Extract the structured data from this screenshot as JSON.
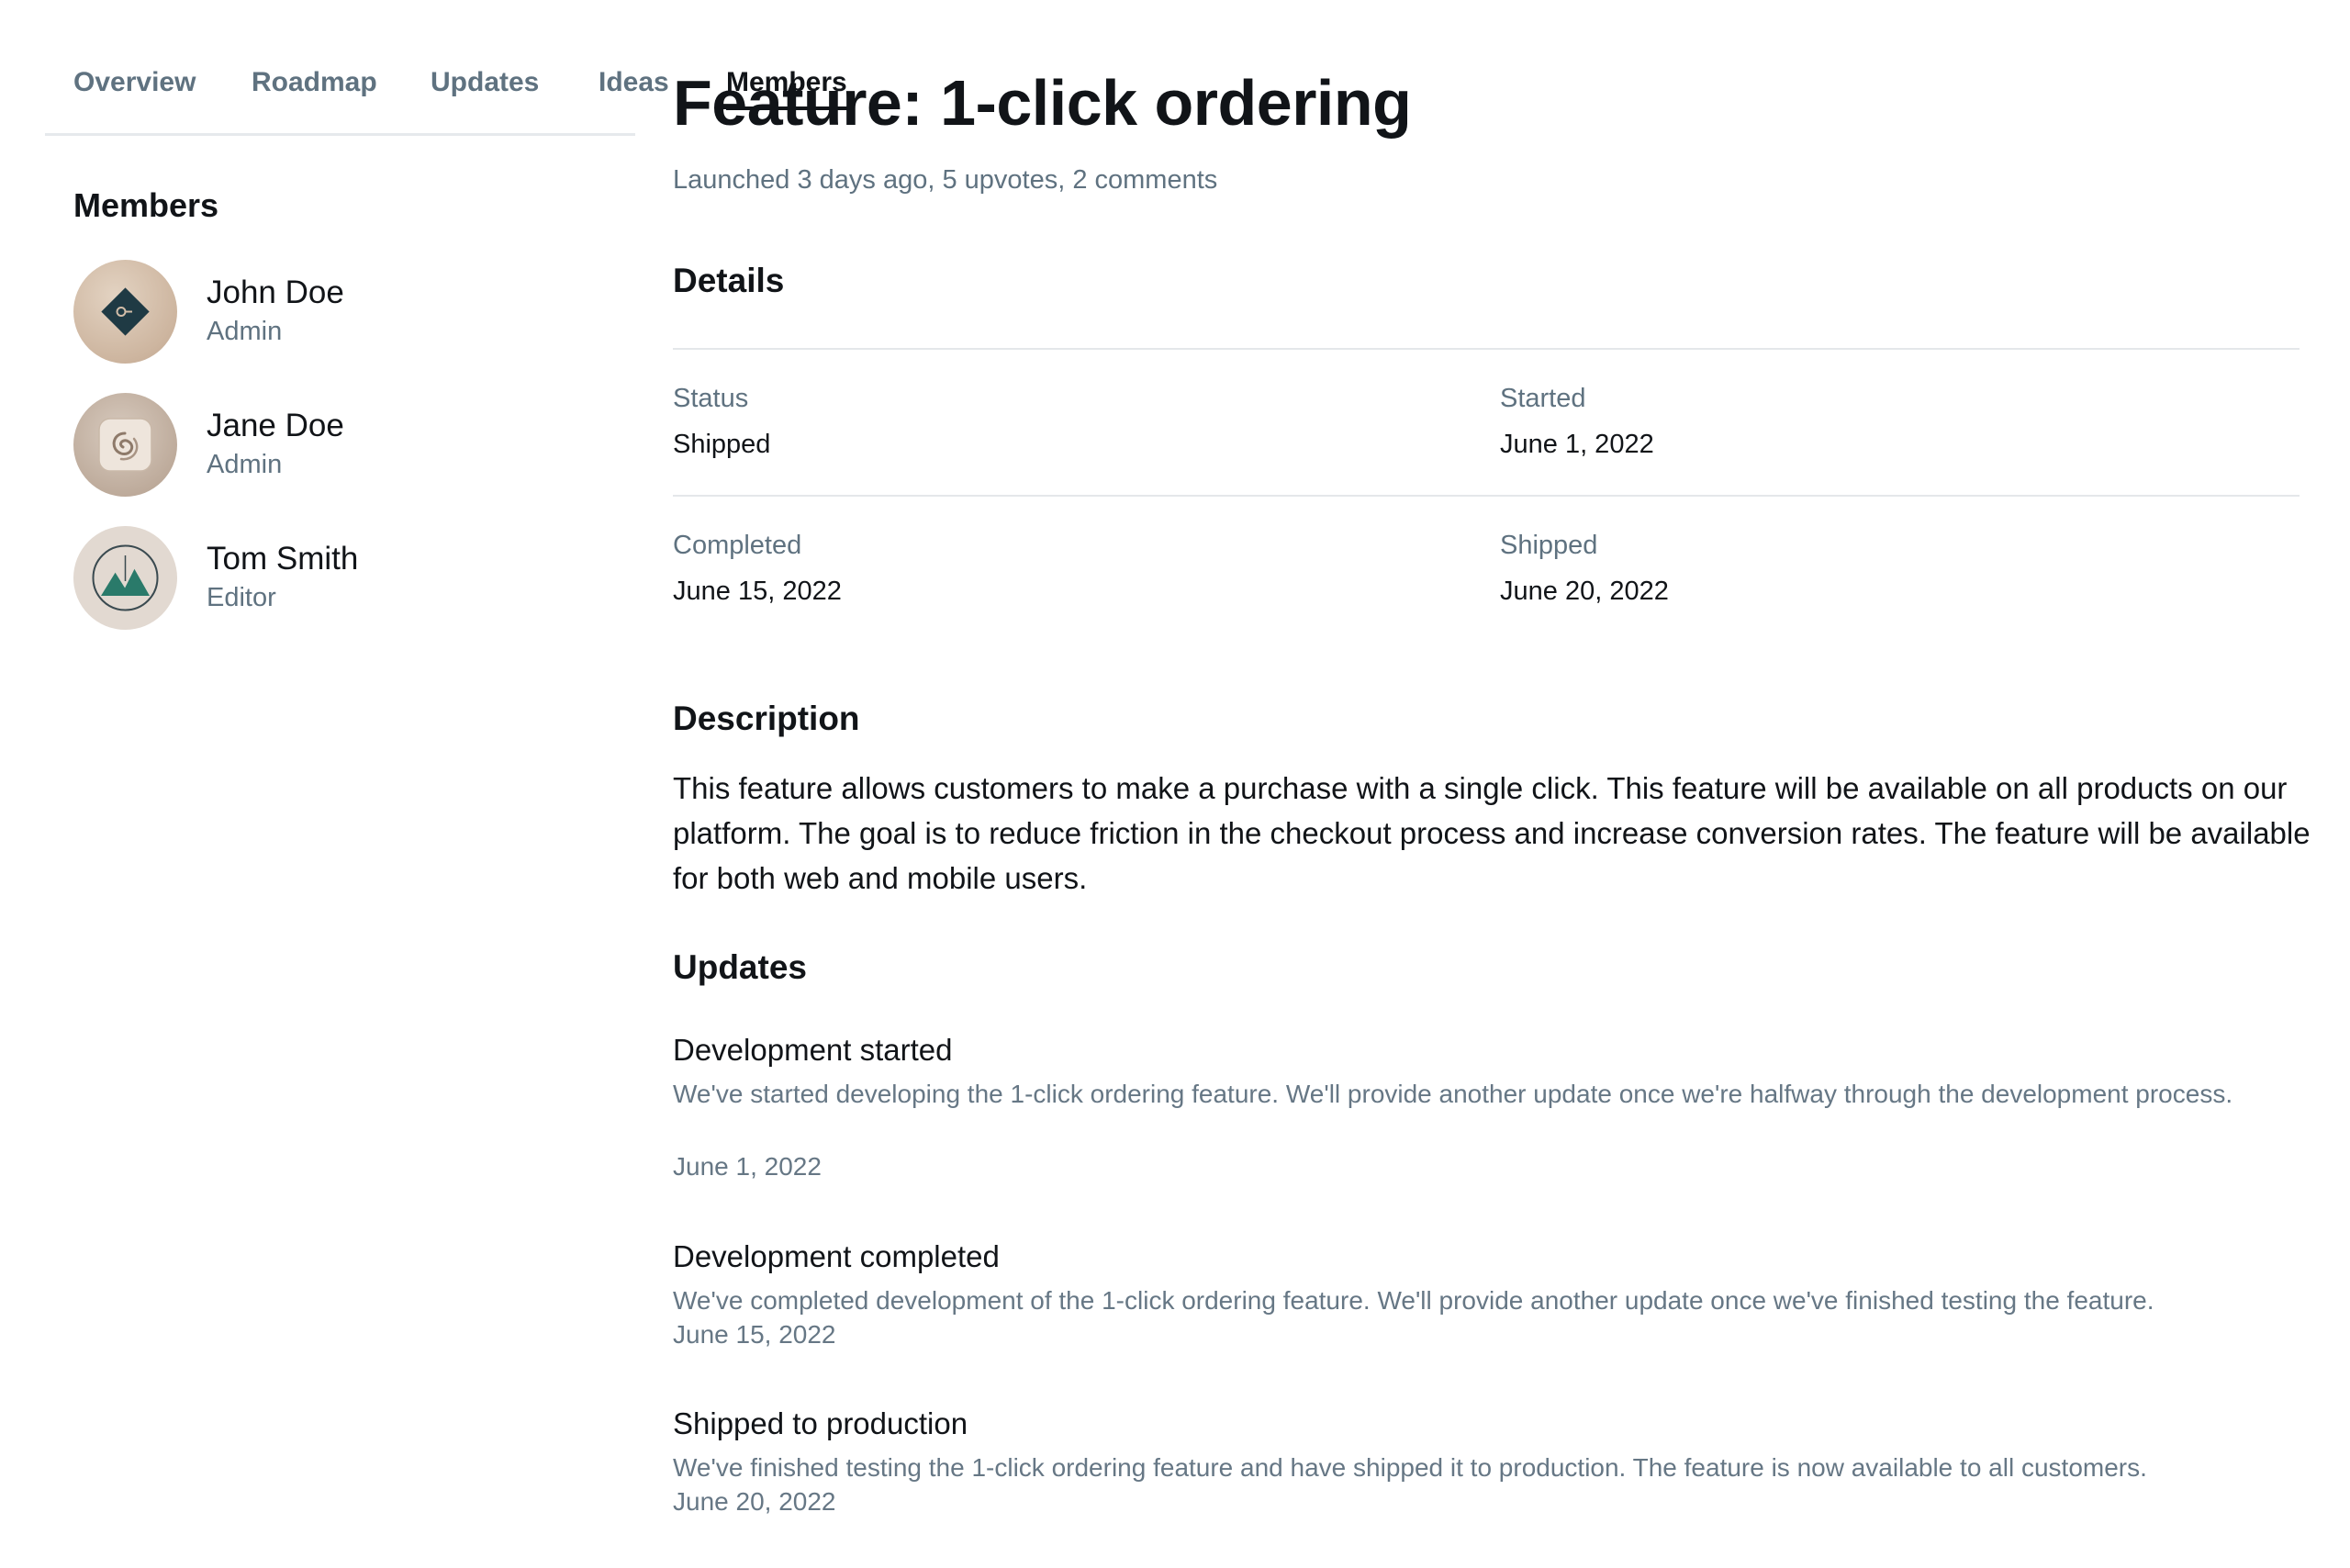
{
  "tabs": [
    {
      "label": "Overview",
      "active": false
    },
    {
      "label": "Roadmap",
      "active": false
    },
    {
      "label": "Updates",
      "active": false
    },
    {
      "label": "Ideas",
      "active": false
    },
    {
      "label": "Members",
      "active": true
    }
  ],
  "sidebar": {
    "heading": "Members",
    "members": [
      {
        "name": "John Doe",
        "role": "Admin",
        "avatar_icon": "diamond-key-icon",
        "avatar_bg": "#d3bea9"
      },
      {
        "name": "Jane Doe",
        "role": "Admin",
        "avatar_icon": "swirl-icon",
        "avatar_bg": "#c4b2a3"
      },
      {
        "name": "Tom Smith",
        "role": "Editor",
        "avatar_icon": "mountain-icon",
        "avatar_bg": "#e2d9d1"
      }
    ]
  },
  "main": {
    "title": "Feature: 1-click ordering",
    "subtitle": "Launched 3 days ago, 5 upvotes, 2 comments",
    "details": {
      "heading": "Details",
      "items": [
        {
          "label": "Status",
          "value": "Shipped"
        },
        {
          "label": "Started",
          "value": "June 1, 2022"
        },
        {
          "label": "Completed",
          "value": "June 15, 2022"
        },
        {
          "label": "Shipped",
          "value": "June 20, 2022"
        }
      ]
    },
    "description": {
      "heading": "Description",
      "text": "This feature allows customers to make a purchase with a single click. This feature will be available on all products on our platform. The goal is to reduce friction in the checkout process and increase conversion rates. The feature will be available for both web and mobile users."
    },
    "updates": {
      "heading": "Updates",
      "items": [
        {
          "title": "Development started",
          "body": "We've started developing the 1-click ordering feature. We'll provide another update once we're halfway through the development process.",
          "date": "June 1, 2022"
        },
        {
          "title": "Development completed",
          "body": "We've completed development of the 1-click ordering feature. We'll provide another update once we've finished testing the feature.",
          "date": "June 15, 2022"
        },
        {
          "title": "Shipped to production",
          "body": "We've finished testing the 1-click ordering feature and have shipped it to production. The feature is now available to all customers.",
          "date": "June 20, 2022"
        }
      ]
    }
  },
  "colors": {
    "text_primary": "#111418",
    "text_muted": "#5f7280",
    "divider": "#e4e7ea",
    "accent_teal": "#2a7a6a",
    "icon_dark": "#1f3a44"
  }
}
